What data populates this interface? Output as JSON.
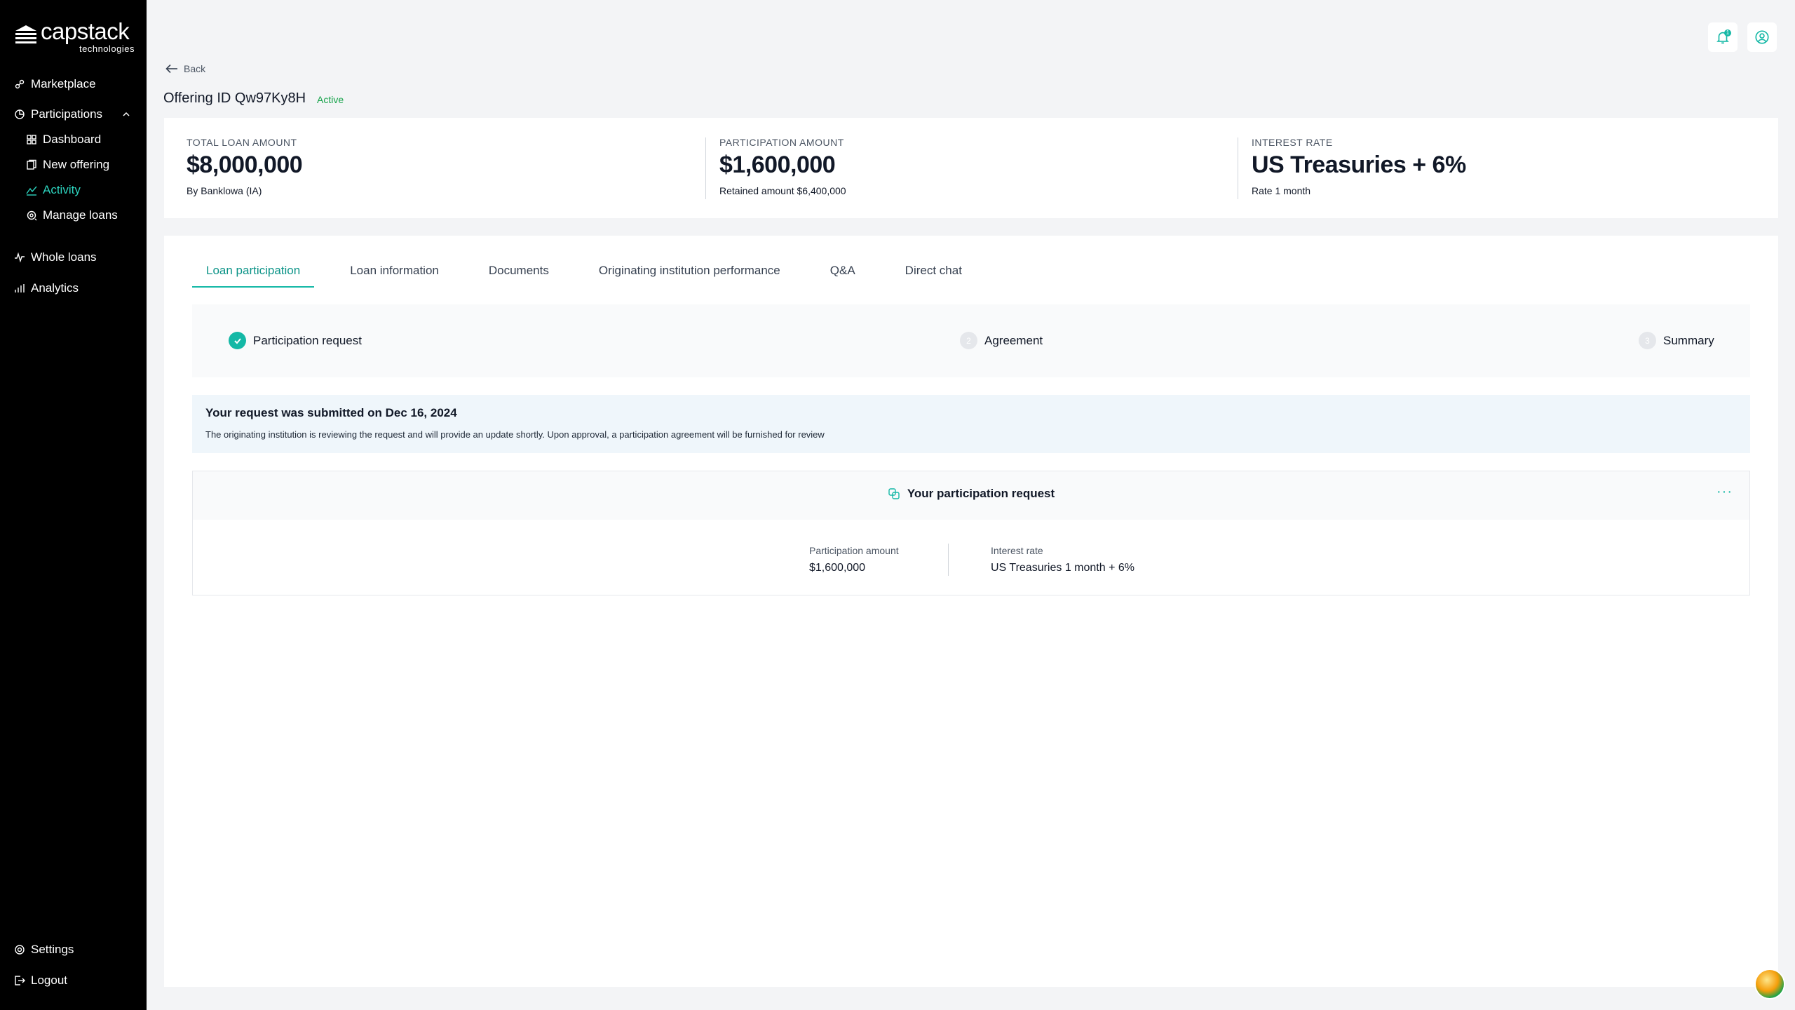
{
  "brand": {
    "name": "capstack",
    "tagline": "technologies"
  },
  "sidebar": {
    "items": [
      {
        "label": "Marketplace",
        "icon": "marketplace-icon"
      },
      {
        "label": "Participations",
        "icon": "participations-icon"
      },
      {
        "label": "Dashboard",
        "icon": "dashboard-icon"
      },
      {
        "label": "New offering",
        "icon": "new-offering-icon"
      },
      {
        "label": "Activity",
        "icon": "activity-icon",
        "active": true
      },
      {
        "label": "Manage loans",
        "icon": "manage-loans-icon"
      },
      {
        "label": "Whole loans",
        "icon": "whole-loans-icon"
      },
      {
        "label": "Analytics",
        "icon": "analytics-icon"
      }
    ],
    "footer": [
      {
        "label": "Settings",
        "icon": "gear-icon"
      },
      {
        "label": "Logout",
        "icon": "logout-icon"
      }
    ]
  },
  "topbar": {
    "notification_count": "1"
  },
  "header": {
    "back_label": "Back",
    "title": "Offering ID Qw97Ky8H",
    "status": "Active"
  },
  "stats": [
    {
      "label": "TOTAL LOAN AMOUNT",
      "value": "$8,000,000",
      "sub": "By Banklowa (IA)"
    },
    {
      "label": "PARTICIPATION AMOUNT",
      "value": "$1,600,000",
      "sub": "Retained amount $6,400,000"
    },
    {
      "label": "INTEREST RATE",
      "value": "US Treasuries + 6%",
      "sub": "Rate 1 month"
    }
  ],
  "tabs": [
    {
      "label": "Loan participation",
      "active": true
    },
    {
      "label": "Loan information"
    },
    {
      "label": "Documents"
    },
    {
      "label": "Originating institution performance"
    },
    {
      "label": "Q&A"
    },
    {
      "label": "Direct chat"
    }
  ],
  "stepper": [
    {
      "number": "1",
      "label": "Participation request",
      "done": true
    },
    {
      "number": "2",
      "label": "Agreement",
      "done": false
    },
    {
      "number": "3",
      "label": "Summary",
      "done": false
    }
  ],
  "notice": {
    "title": "Your request was submitted on Dec 16, 2024",
    "body": "The originating institution is reviewing the request and will provide an update shortly. Upon approval, a participation agreement will be furnished for review"
  },
  "request_card": {
    "title": "Your participation request",
    "more_label": "···",
    "fields": [
      {
        "label": "Participation amount",
        "value": "$1,600,000"
      },
      {
        "label": "Interest rate",
        "value": "US Treasuries 1 month + 6%"
      }
    ]
  },
  "colors": {
    "accent": "#14b8a6",
    "sidebar_bg": "#000000",
    "page_bg": "#f3f4f6",
    "status_active": "#16a34a"
  }
}
